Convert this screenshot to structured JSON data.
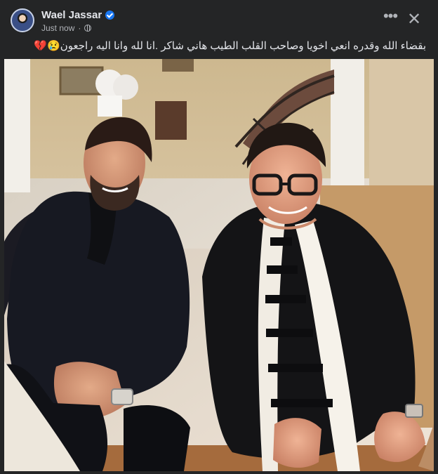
{
  "post": {
    "author": "Wael Jassar",
    "timestamp": "Just now",
    "caption": "بقضاء الله وقدره انعي اخويا وصاحب القلب الطيب هاني شاكر .انا لله وانا اليه راجعون😢💔",
    "icons": {
      "avatar": "profile-avatar",
      "verified": "verified-badge-icon",
      "privacy": "globe-icon",
      "more": "more-options-icon",
      "close": "close-icon"
    },
    "colors": {
      "background": "#242526",
      "text": "#e4e6eb",
      "secondary_text": "#b0b3b8",
      "verified": "#1877f2"
    }
  },
  "toolbar": {
    "more_label": "•••",
    "close_label": "✕"
  }
}
